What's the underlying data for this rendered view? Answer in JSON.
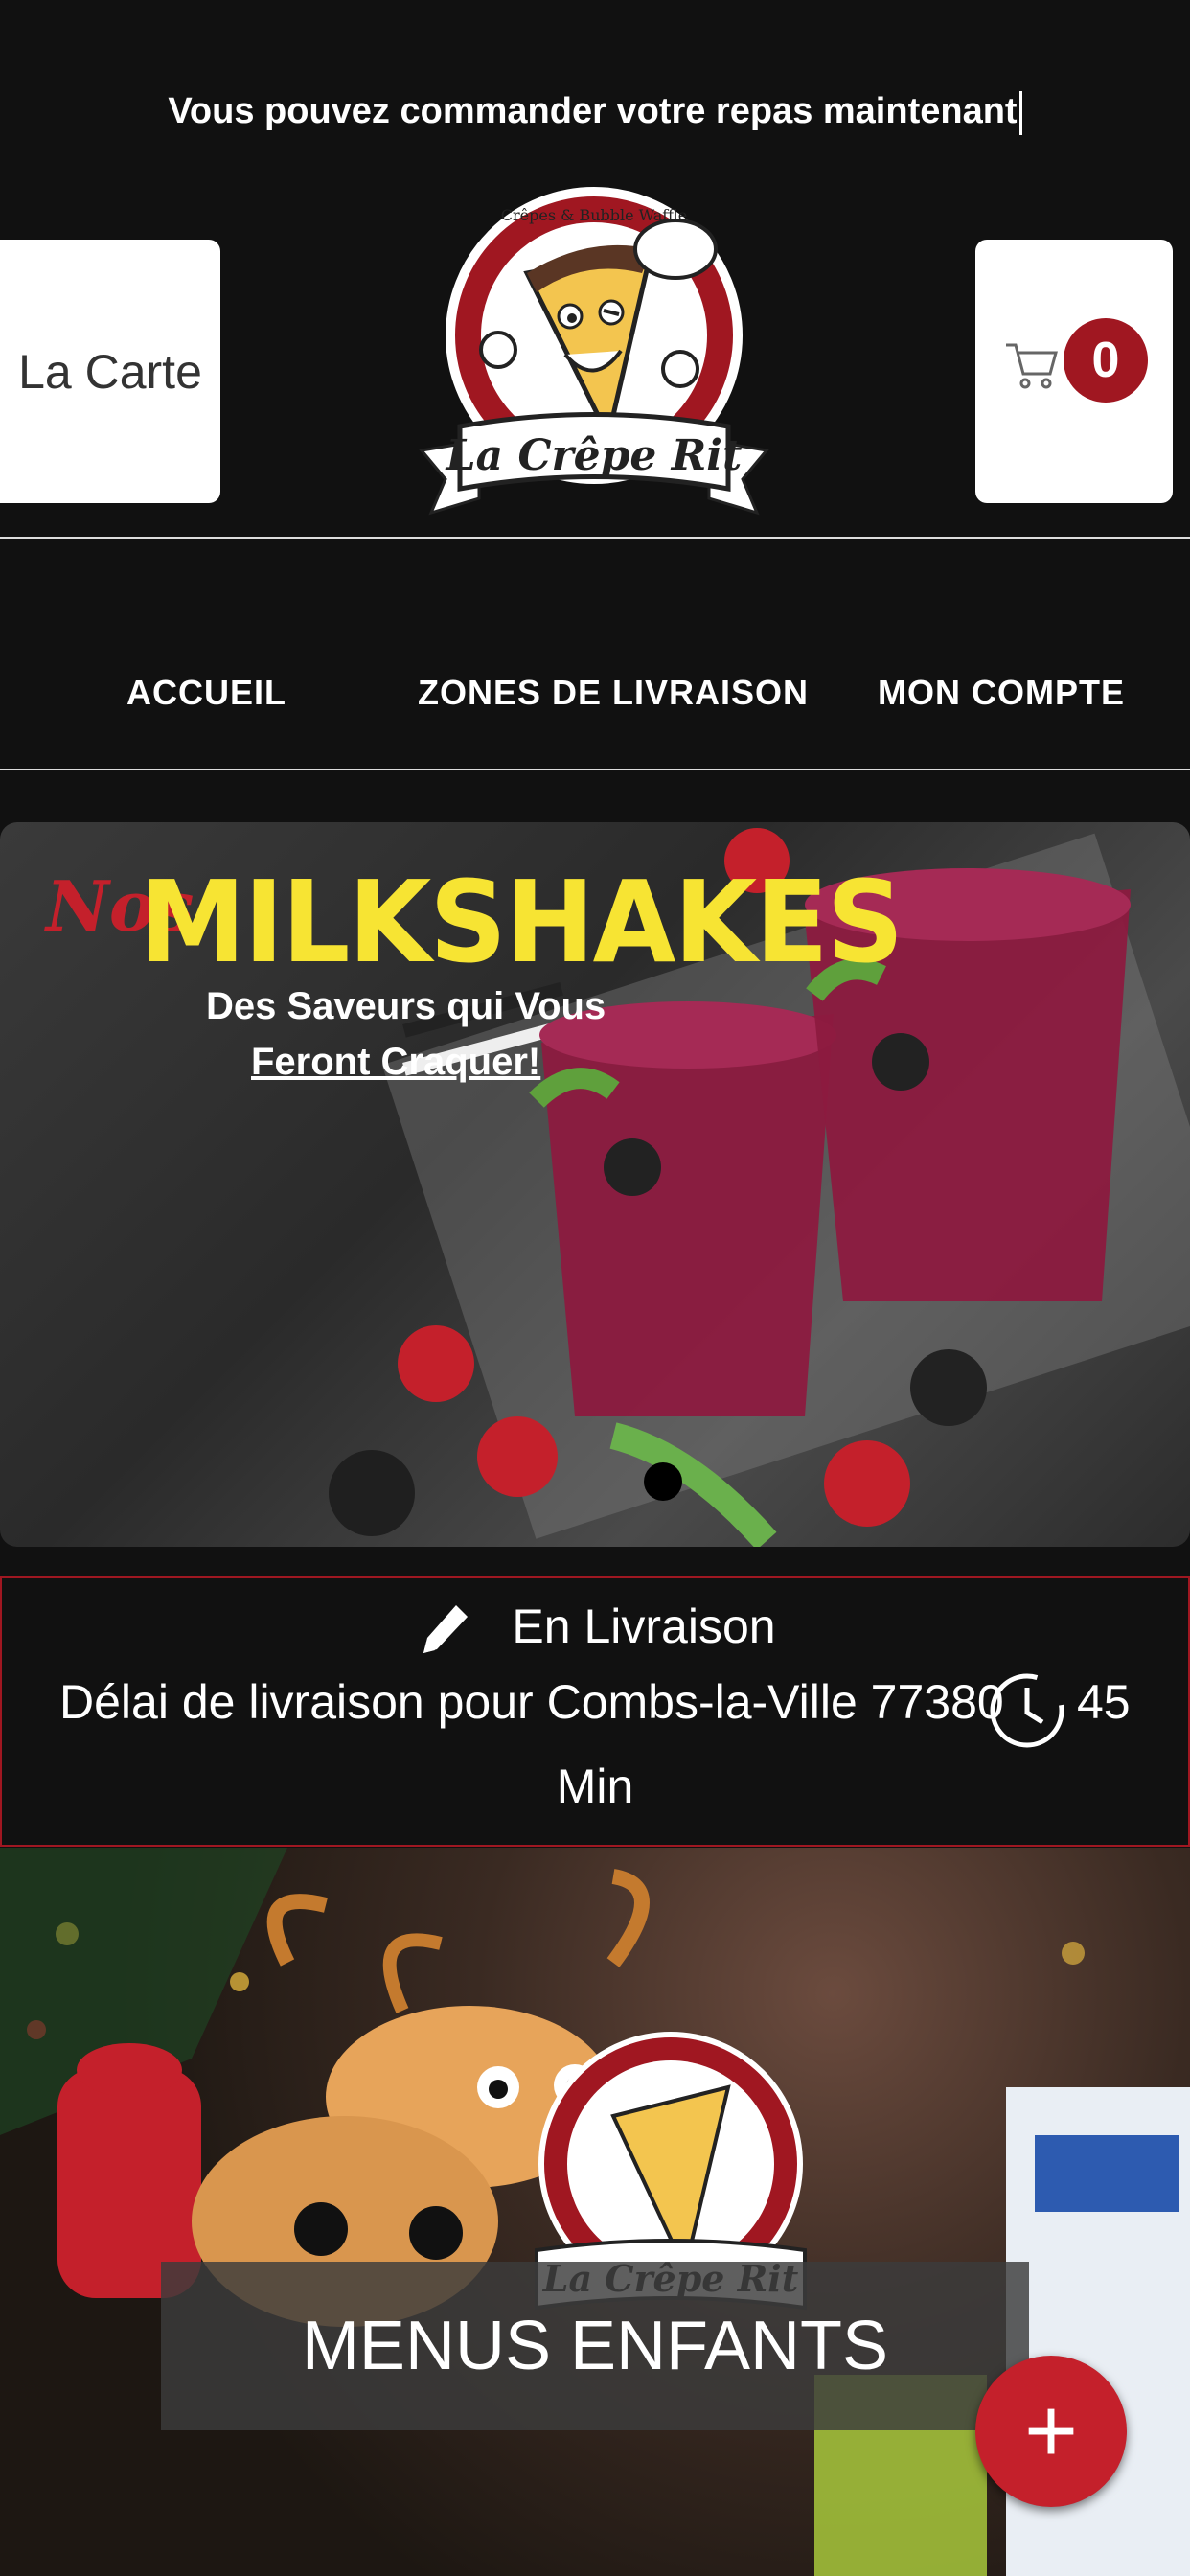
{
  "header": {
    "announcement": "Vous pouvez commander votre repas maintenant",
    "menu_button": "La Carte",
    "cart_count": "0",
    "logo_text": "La Crêpe Rit",
    "logo_subtext": "Crêpes & Bubble Waffle"
  },
  "nav": {
    "items": [
      "ACCUEIL",
      "ZONES DE LIVRAISON",
      "MON COMPTE"
    ]
  },
  "banner": {
    "prefix": "Nos",
    "title": "MILKSHAKES",
    "subtitle_line1": "Des Saveurs qui Vous",
    "subtitle_line2": "Feront Craquer!"
  },
  "delivery": {
    "mode": "En Livraison",
    "line": "Délai de livraison pour Combs-la-Ville 77380",
    "time": "45",
    "unit": "Min"
  },
  "category": {
    "title": "MENUS ENFANTS"
  },
  "colors": {
    "accent": "#a01721",
    "brand_red": "#c4202b",
    "banner_yellow": "#f7e433"
  }
}
